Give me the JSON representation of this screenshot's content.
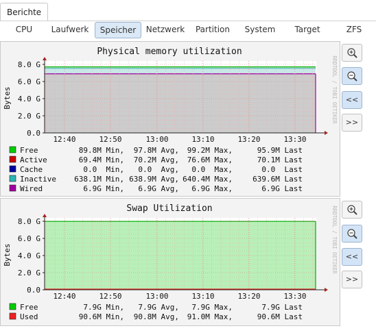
{
  "top_tab": "Berichte",
  "subtabs": [
    "CPU",
    "Laufwerk",
    "Speicher",
    "Netzwerk",
    "Partition",
    "System",
    "Target",
    "ZFS"
  ],
  "active_subtab": "Speicher",
  "watermark": "RRDTOOL / TOBI OETIKER",
  "side_buttons": {
    "zoom_in": "zoom-in-icon",
    "zoom_out": "zoom-out-icon",
    "back": "<<",
    "forward": ">>"
  },
  "colors": {
    "free": "#00cc00",
    "active": "#cc0000",
    "cache": "#0000a0",
    "inactive": "#2cb3b3",
    "wired": "#a000a0",
    "used": "#ee2222"
  },
  "chart_data": [
    {
      "type": "area",
      "title": "Physical memory utilization",
      "ylabel": "Bytes",
      "yticks": [
        "0.0",
        "2.0 G",
        "4.0 G",
        "6.0 G",
        "8.0 G"
      ],
      "xticks": [
        "12:40",
        "12:50",
        "13:00",
        "13:10",
        "13:20",
        "13:30"
      ],
      "ylim": [
        0,
        8.8
      ],
      "series": [
        {
          "name": "Free",
          "color": "#00cc00",
          "min": "89.8M Min,",
          "avg": "97.8M Avg,",
          "max": "99.2M Max,",
          "last": "95.9M Last"
        },
        {
          "name": "Active",
          "color": "#cc0000",
          "min": "69.4M Min,",
          "avg": "70.2M Avg,",
          "max": "76.6M Max,",
          "last": "70.1M Last"
        },
        {
          "name": "Cache",
          "color": "#0000a0",
          "min": "0.0  Min,",
          "avg": "0.0  Avg,",
          "max": "0.0  Max,",
          "last": "0.0  Last"
        },
        {
          "name": "Inactive",
          "color": "#2cb3b3",
          "min": "638.1M Min,",
          "avg": "638.9M Avg,",
          "max": "640.4M Max,",
          "last": "639.6M Last"
        },
        {
          "name": "Wired",
          "color": "#a000a0",
          "min": "6.9G Min,",
          "avg": "6.9G Avg,",
          "max": "6.9G Max,",
          "last": "6.9G Last"
        }
      ],
      "stack_values_gb": {
        "wired": 6.9,
        "inactive": 0.64,
        "active": 0.07,
        "free": 0.1
      }
    },
    {
      "type": "area",
      "title": "Swap Utilization",
      "ylabel": "Bytes",
      "yticks": [
        "0.0",
        "2.0 G",
        "4.0 G",
        "6.0 G",
        "8.0 G"
      ],
      "xticks": [
        "12:40",
        "12:50",
        "13:00",
        "13:10",
        "13:20",
        "13:30"
      ],
      "ylim": [
        0,
        8.8
      ],
      "series": [
        {
          "name": "Free",
          "color": "#00cc00",
          "min": "7.9G Min,",
          "avg": "7.9G Avg,",
          "max": "7.9G Max,",
          "last": "7.9G Last"
        },
        {
          "name": "Used",
          "color": "#ee2222",
          "min": "90.6M Min,",
          "avg": "90.8M Avg,",
          "max": "91.0M Max,",
          "last": "90.6M Last"
        }
      ],
      "stack_values_gb": {
        "used": 0.09,
        "free": 7.9
      }
    }
  ]
}
